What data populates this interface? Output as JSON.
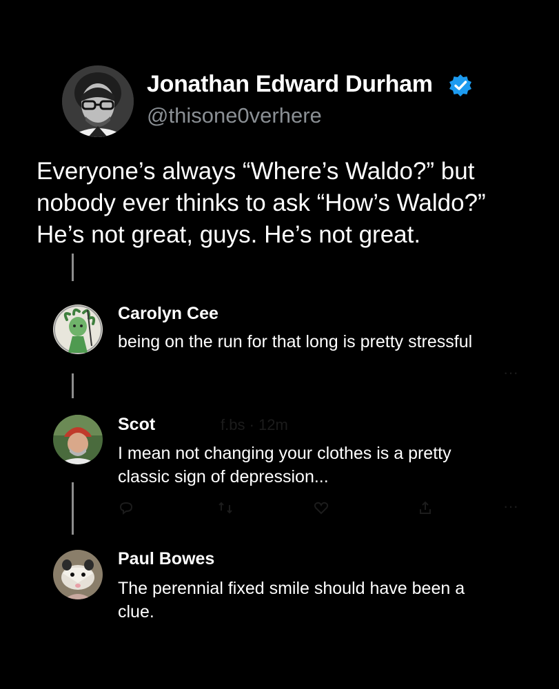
{
  "main_tweet": {
    "author_name": "Jonathan Edward Durham",
    "author_handle": "@thisone0verhere",
    "verified_icon": "verified-badge-icon",
    "text_lines": [
      "Everyone’s always “Where’s Waldo?” but",
      "nobody ever thinks to ask “How’s Waldo?”",
      "He’s not great, guys. He’s not great."
    ]
  },
  "replies": [
    {
      "name": "Carolyn Cee",
      "text_lines": [
        "being on the run for that long is pretty stressful"
      ],
      "avatar_icon": "medusa-avatar"
    },
    {
      "name": "Scot",
      "faint_meta": "f.bs · 12m",
      "text_lines": [
        "I mean not changing your clothes is a pretty",
        "classic sign of depression..."
      ],
      "avatar_icon": "man-cap-avatar"
    },
    {
      "name": "Paul Bowes",
      "text_lines": [
        "The perennial fixed smile should have been a",
        "clue."
      ],
      "avatar_icon": "opossum-avatar"
    }
  ],
  "colors": {
    "background": "#000000",
    "text": "#ffffff",
    "handle": "#8a8f94",
    "verified": "#1d9bf0",
    "thread_line": "#8e8e8e"
  }
}
